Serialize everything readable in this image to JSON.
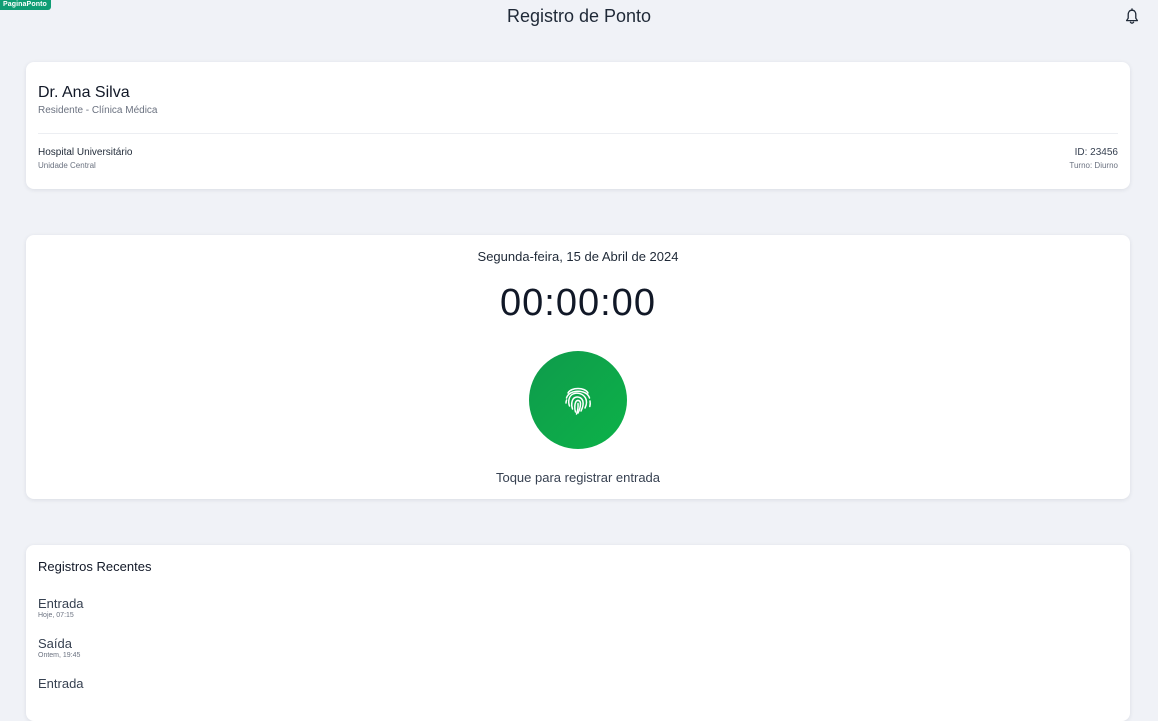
{
  "badge": "PaginaPonto",
  "header": {
    "title": "Registro de Ponto",
    "bell_icon": "bell-icon"
  },
  "profile": {
    "name": "Dr. Ana Silva",
    "role": "Residente - Clínica Médica",
    "hospital": "Hospital Universitário",
    "unit": "Unidade Central",
    "id": "ID: 23456",
    "shift": "Turno: Diurno"
  },
  "clock": {
    "date": "Segunda-feira, 15 de Abril de 2024",
    "time": "00:00:00",
    "button_icon": "fingerprint-icon",
    "hint": "Toque para registrar entrada",
    "accent_color": "#0ea84a"
  },
  "recent": {
    "title": "Registros Recentes",
    "items": [
      {
        "type": "Entrada",
        "when": "Hoje, 07:15"
      },
      {
        "type": "Saída",
        "when": "Ontem, 19:45"
      },
      {
        "type": "Entrada",
        "when": ""
      }
    ]
  }
}
